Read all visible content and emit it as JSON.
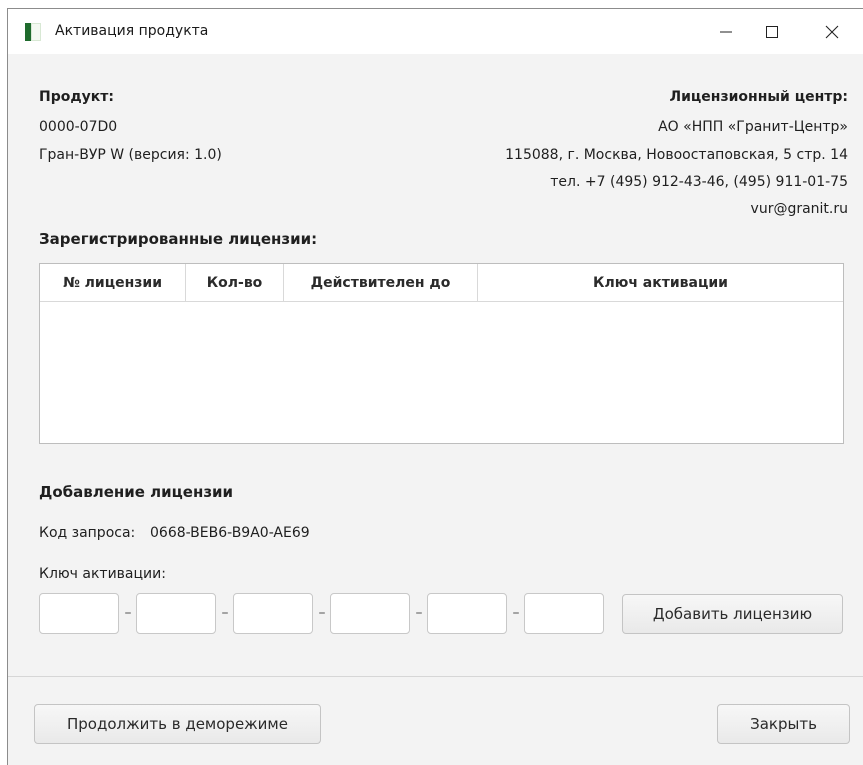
{
  "window": {
    "title": "Активация продукта",
    "icon": "book-icon"
  },
  "product": {
    "label": "Продукт:",
    "code": "0000-07D0",
    "name": "Гран-ВУР W (версия: 1.0)"
  },
  "license_center": {
    "label": "Лицензионный центр:",
    "org": "АО «НПП «Гранит-Центр»",
    "address": "115088, г. Москва, Новоостаповская, 5 стр. 14",
    "phone": "тел. +7 (495) 912-43-46, (495) 911-01-75",
    "email": "vur@granit.ru"
  },
  "registered": {
    "heading": "Зарегистрированные лицензии:",
    "columns": [
      "№ лицензии",
      "Кол-во",
      "Действителен до",
      "Ключ активации"
    ],
    "rows": []
  },
  "add_license": {
    "heading": "Добавление лицензии",
    "request_code_label": "Код запроса:",
    "request_code_value": "0668-BEB6-B9A0-AE69",
    "activation_key_label": "Ключ активации:",
    "key_parts": [
      "",
      "",
      "",
      "",
      "",
      ""
    ],
    "separator": "–",
    "add_button": "Добавить лицензию"
  },
  "footer": {
    "demo_button": "Продолжить в деморежиме",
    "close_button": "Закрыть"
  },
  "colors": {
    "window_bg": "#f3f3f3",
    "titlebar_bg": "#ffffff",
    "icon_green": "#2e8b3e"
  }
}
